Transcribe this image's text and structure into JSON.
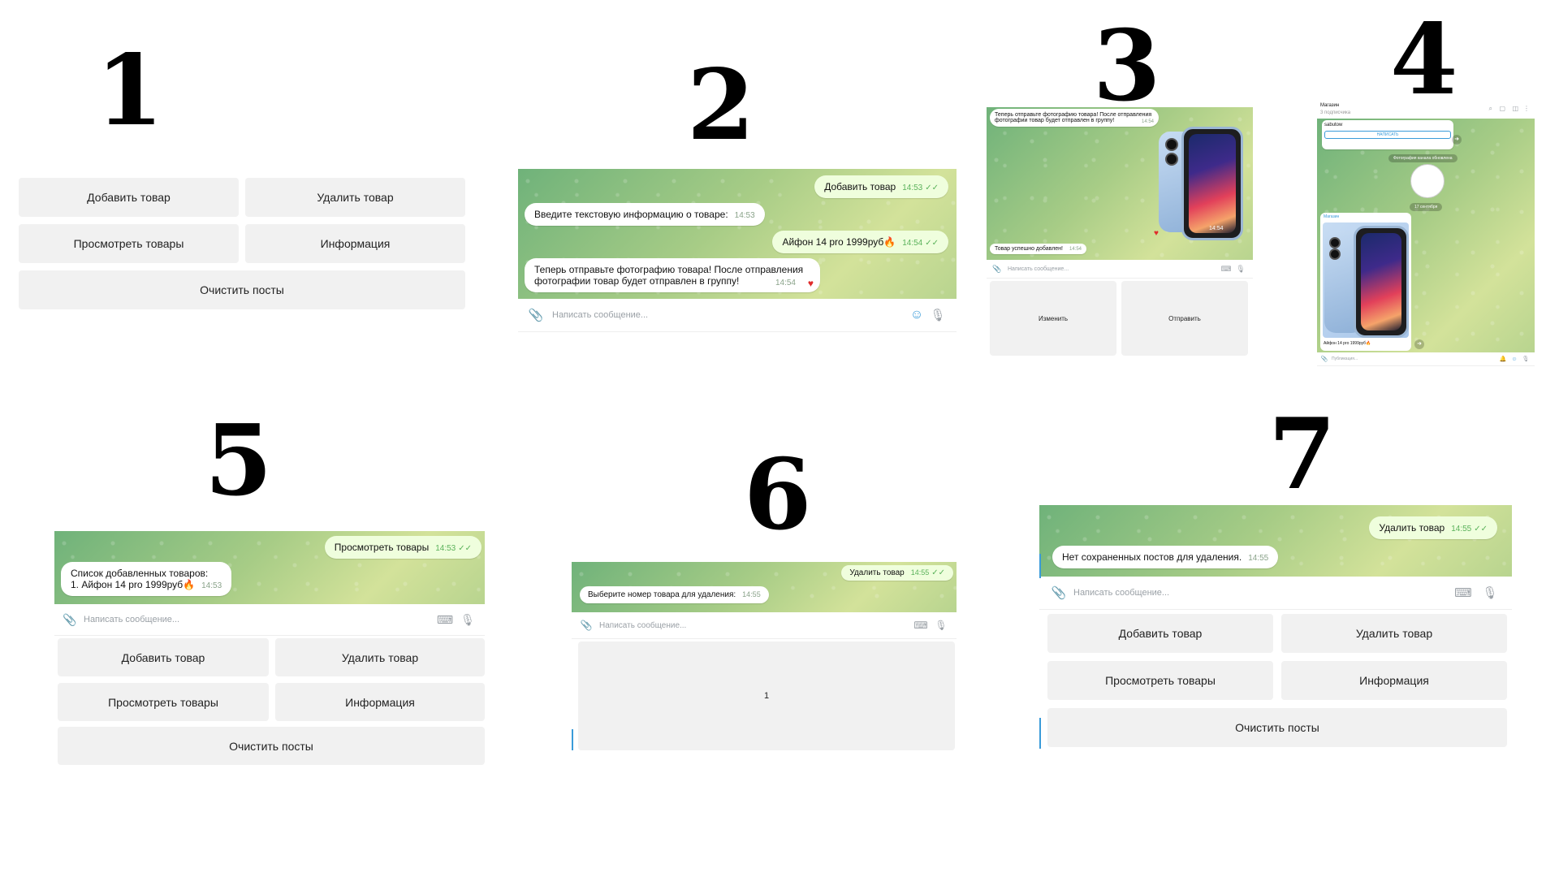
{
  "numbers": [
    "1",
    "2",
    "3",
    "4",
    "5",
    "6",
    "7"
  ],
  "buttons": {
    "add": "Добавить товар",
    "delete": "Удалить товар",
    "view": "Просмотреть товары",
    "info": "Информация",
    "clear": "Очистить посты",
    "edit": "Изменить",
    "send": "Отправить",
    "one": "1"
  },
  "input": {
    "placeholder": "Написать сообщение..."
  },
  "panel2": {
    "m1": {
      "text": "Добавить товар",
      "time": "14:53"
    },
    "m2": {
      "text": "Введите текстовую информацию о товаре:",
      "time": "14:53"
    },
    "m3": {
      "text": "Айфон 14 pro 1999руб🔥",
      "time": "14:54"
    },
    "m4": {
      "line1": "Теперь отправьте фотографию товара! После отправления",
      "line2": "фотографии товар будет отправлен в группу!",
      "time": "14:54"
    }
  },
  "panel3": {
    "m1": {
      "line1": "Теперь отправьте фотографию товара! После отправления",
      "line2": "фотографии товар будет отправлен в группу!",
      "time": "14:54"
    },
    "m2": {
      "text": "Товар успешно добавлен!",
      "time": "14:54"
    },
    "phototime": "14:54"
  },
  "panel4": {
    "channel": "Магазин",
    "subscribers": "3 подписчика",
    "user": "sabutow",
    "write": "НАПИСАТЬ",
    "date_label": "Фотография канала обновлена",
    "date": "17 сентября",
    "post_author": "Магазин",
    "caption": "Айфон 14 pro 1999руб🔥",
    "footer": "Публикация..."
  },
  "panel5": {
    "m1": {
      "text": "Просмотреть товары",
      "time": "14:53"
    },
    "m2": {
      "line1": "Список добавленных товаров:",
      "line2": "1. Айфон 14 pro 1999руб🔥",
      "time": "14:53"
    }
  },
  "panel6": {
    "m1": {
      "text": "Удалить товар",
      "time": "14:55"
    },
    "m2": {
      "text": "Выберите номер товара для удаления:",
      "time": "14:55"
    }
  },
  "panel7": {
    "m1": {
      "text": "Удалить товар",
      "time": "14:55"
    },
    "m2": {
      "text": "Нет сохраненных постов для удаления.",
      "time": "14:55"
    }
  },
  "icons": {
    "attach": "paperclip-icon",
    "emoji": "emoji-icon",
    "mic": "microphone-icon",
    "keyboard": "keyboard-icon"
  }
}
